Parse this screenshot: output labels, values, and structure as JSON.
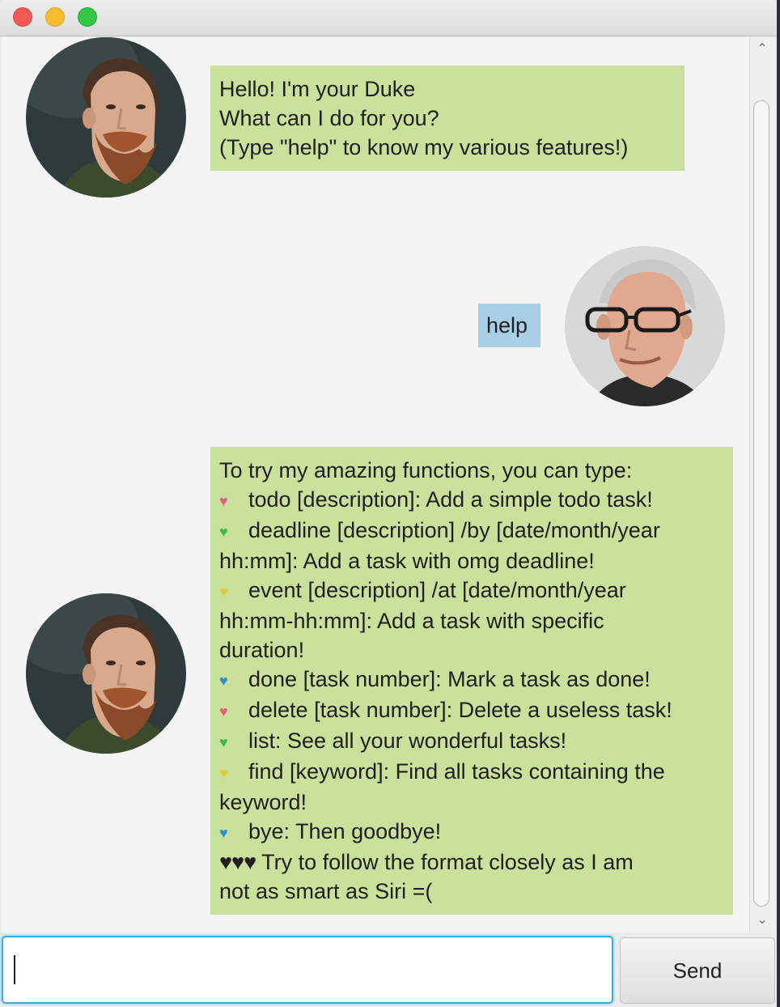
{
  "window": {
    "controls": [
      "close",
      "minimize",
      "maximize"
    ]
  },
  "messages": [
    {
      "sender": "duke",
      "lines": [
        "Hello! I'm your Duke",
        "What can I do for you?",
        "(Type \"help\" to know my various features!)"
      ]
    },
    {
      "sender": "user",
      "text": "help"
    },
    {
      "sender": "duke",
      "intro": "To try my amazing functions, you can type:",
      "items": [
        {
          "icon": "pink-heart-icon",
          "heart": "♥",
          "line1": "todo [description]: Add a simple todo task!",
          "line2": ""
        },
        {
          "icon": "green-heart-icon",
          "heart": "♥",
          "line1": "deadline [description] /by [date/month/year",
          "line2": "hh:mm]: Add a task with omg deadline!"
        },
        {
          "icon": "yellow-heart-icon",
          "heart": "♥",
          "line1": "event [description] /at [date/month/year",
          "line2": "hh:mm-hh:mm]: Add a task with specific",
          "line3": "duration!"
        },
        {
          "icon": "blue-heart-icon",
          "heart": "♥",
          "line1": "done [task number]: Mark a task as done!",
          "line2": ""
        },
        {
          "icon": "pink-heart-icon",
          "heart": "♥",
          "line1": "delete [task number]: Delete a useless task!",
          "line2": ""
        },
        {
          "icon": "green-heart-icon",
          "heart": "♥",
          "line1": "list: See all your wonderful tasks!",
          "line2": ""
        },
        {
          "icon": "yellow-heart-icon",
          "heart": "♥",
          "line1": "find [keyword]: Find all tasks containing the",
          "line2": "keyword!"
        },
        {
          "icon": "blue-heart-icon",
          "heart": "♥",
          "line1": "bye: Then goodbye!",
          "line2": ""
        }
      ],
      "outro_hearts": "♥♥♥",
      "outro_line1": " Try to follow the format closely as I am",
      "outro_line2": "not as smart as Siri =("
    }
  ],
  "input": {
    "value": "",
    "placeholder": ""
  },
  "send_label": "Send",
  "colors": {
    "duke_bubble": "#cbe09b",
    "user_bubble": "#a8cfe6",
    "chat_background": "#f4f4f4",
    "input_focus": "#3aa9e0"
  }
}
